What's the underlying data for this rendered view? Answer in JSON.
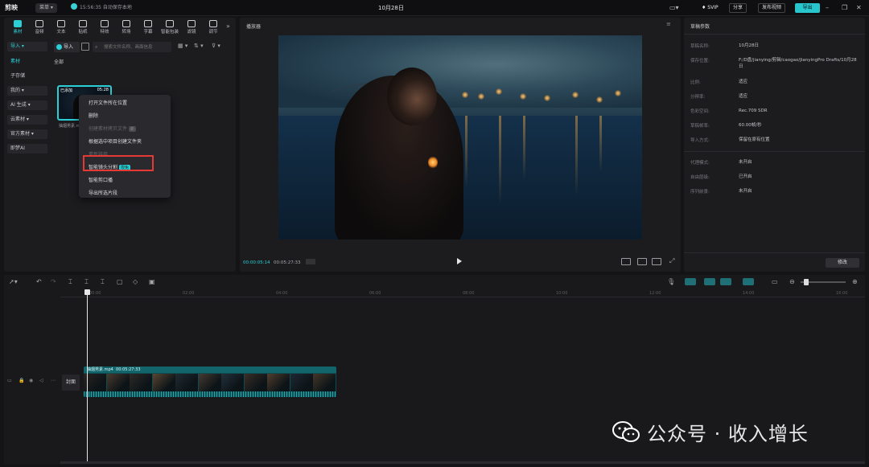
{
  "titlebar": {
    "logo": "剪映",
    "menu": "菜单",
    "autosave": "15:56:35 自动保存本地",
    "project_title": "10月28日",
    "svip": "SVIP",
    "share": "分享",
    "publish": "发布视频",
    "export": "导出"
  },
  "media_tabs": [
    {
      "label": "素材",
      "active": true
    },
    {
      "label": "音频"
    },
    {
      "label": "文本"
    },
    {
      "label": "贴纸"
    },
    {
      "label": "特效"
    },
    {
      "label": "转场"
    },
    {
      "label": "字幕"
    },
    {
      "label": "智能包装"
    },
    {
      "label": "滤镜"
    },
    {
      "label": "调节"
    }
  ],
  "media_sidebar": [
    {
      "label": "导入 ▾"
    },
    {
      "label": "素材"
    },
    {
      "label": "子存储"
    },
    {
      "label": "我的 ▾"
    },
    {
      "label": "AI 生成 ▾"
    },
    {
      "label": "云素材 ▾"
    },
    {
      "label": "官方素材 ▾"
    },
    {
      "label": "即梦AI"
    }
  ],
  "media_toolbar": {
    "import": "导入",
    "search_placeholder": "搜索文件名称、画面信息"
  },
  "media_section_title": "全部",
  "media_item": {
    "badge": "已添加",
    "duration": "05:28",
    "name": "抽烟男素.mp4"
  },
  "context_menu": [
    {
      "label": "打开文件所在位置",
      "disabled": false
    },
    {
      "label": "删除",
      "disabled": false
    },
    {
      "label": "创建素材拷贝文件",
      "disabled": true,
      "badge": "新"
    },
    {
      "label": "根据选中项目创建文件夹",
      "disabled": false
    },
    {
      "label": "重新链接",
      "disabled": true
    },
    {
      "label": "智能镜头分割",
      "disabled": false,
      "badge": "限免"
    },
    {
      "label": "智能剪口播",
      "disabled": false
    },
    {
      "label": "导出所选片段",
      "disabled": false
    }
  ],
  "preview": {
    "title": "播放器",
    "current_time": "00:00:05:14",
    "total_time": "00:05:27:33"
  },
  "properties": {
    "title": "草稿参数",
    "rows": [
      {
        "label": "草稿名称:",
        "value": "10月28日"
      },
      {
        "label": "保存位置:",
        "value": "F:/D盘/jianying/剪辑/caogao/JianyingPro Drafts/10月28日"
      },
      {
        "label": "比例:",
        "value": "适应"
      },
      {
        "label": "分辨率:",
        "value": "适应"
      },
      {
        "label": "色彩空间:",
        "value": "Rec.709 SDR"
      },
      {
        "label": "草稿帧率:",
        "value": "60.00帧/秒"
      },
      {
        "label": "导入方式:",
        "value": "保留在原有位置"
      },
      {
        "label": "代理模式:",
        "value": "未开启"
      },
      {
        "label": "自由层级:",
        "value": "已开启"
      },
      {
        "label": "序列前景:",
        "value": "未开启"
      }
    ],
    "edit_button": "修改"
  },
  "timeline": {
    "ruler_ticks": [
      "00:00",
      "02:00",
      "04:00",
      "06:00",
      "08:00",
      "10:00",
      "12:00",
      "14:00",
      "16:00"
    ],
    "cover_label": "封面",
    "clip_name": "抽烟男素.mp4",
    "clip_duration": "00:05:27:33"
  },
  "watermark": "公众号 · 收入增长"
}
